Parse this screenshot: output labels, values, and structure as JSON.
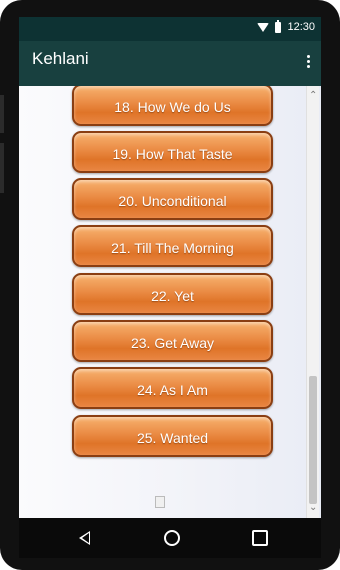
{
  "status_bar": {
    "time": "12:30",
    "icons": [
      "wifi-icon",
      "battery-icon"
    ]
  },
  "app_bar": {
    "title": "Kehlani",
    "menu_icon": "overflow-menu-icon"
  },
  "songs": [
    "18. How We do Us",
    "19. How That Taste",
    "20. Unconditional",
    "21. Till The Morning",
    "22. Yet",
    "23. Get Away",
    "24. As I Am",
    "25. Wanted"
  ],
  "navigation": {
    "icons": [
      "back-icon",
      "home-icon",
      "recents-icon"
    ]
  },
  "colors": {
    "status_bar": "#0d3233",
    "app_bar": "#18403f",
    "button_orange": "#ea8a43",
    "button_border": "#8a3e12"
  }
}
